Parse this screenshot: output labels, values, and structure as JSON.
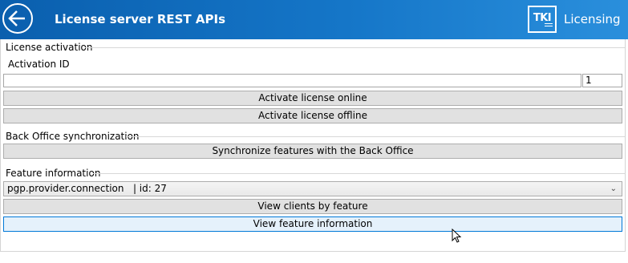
{
  "header": {
    "title": "License server REST APIs",
    "logo_text": "TKI",
    "brand": "Licensing"
  },
  "activation": {
    "group_label": "License activation",
    "id_label": "Activation ID",
    "id_value": "",
    "count_value": "1",
    "online_button": "Activate license online",
    "offline_button": "Activate license offline"
  },
  "backoffice": {
    "group_label": "Back Office synchronization",
    "sync_button": "Synchronize features with the Back Office"
  },
  "feature": {
    "group_label": "Feature information",
    "selected": "pgp.provider.connection   | id: 27",
    "clients_button": "View clients by feature",
    "info_button": "View feature information"
  },
  "colors": {
    "header_start": "#0a5fae",
    "header_end": "#2a8fdc",
    "button_bg": "#e1e1e1",
    "button_hover_bg": "#e5f1fb",
    "button_hover_border": "#0078d7"
  },
  "icons": {
    "back": "back-arrow-icon",
    "dropdown": "chevron-down-icon",
    "cursor": "mouse-pointer-icon"
  }
}
